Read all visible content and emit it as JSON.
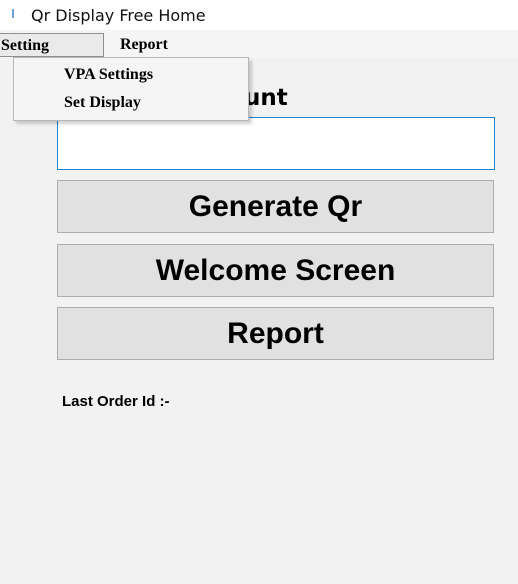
{
  "window": {
    "title": "Qr Display Free Home"
  },
  "menubar": {
    "items": [
      {
        "label": "Setting"
      },
      {
        "label": "Report"
      }
    ]
  },
  "dropdown": {
    "items": [
      {
        "label": "VPA Settings"
      },
      {
        "label": "Set Display"
      }
    ]
  },
  "main": {
    "amount_label_visible_fragment": "unt",
    "amount_input_value": "",
    "buttons": {
      "generate": "Generate Qr",
      "welcome": "Welcome Screen",
      "report": "Report"
    },
    "last_order_label": "Last Order Id :-"
  },
  "colors": {
    "input_border": "#1e88d8",
    "button_bg": "#e1e1e1",
    "client_bg": "#f2f2f2"
  }
}
